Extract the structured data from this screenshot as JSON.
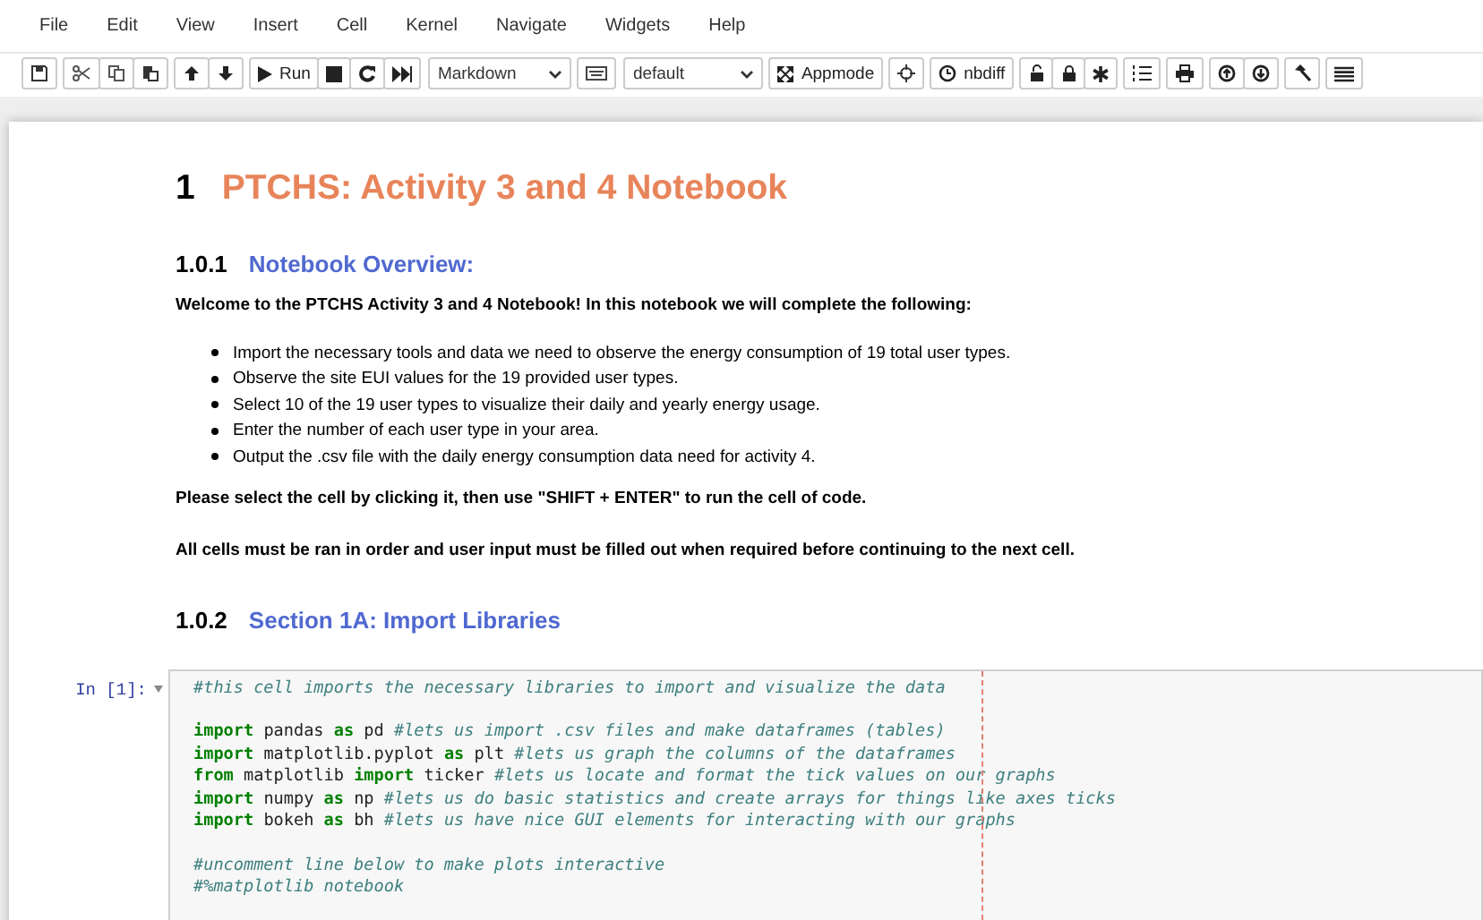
{
  "menu": [
    "File",
    "Edit",
    "View",
    "Insert",
    "Cell",
    "Kernel",
    "Navigate",
    "Widgets",
    "Help"
  ],
  "toolbar": {
    "run_label": "Run",
    "cell_type": "Markdown",
    "theme": "default",
    "appmode_label": "Appmode",
    "nbdiff_label": "nbdiff"
  },
  "heading": {
    "number": "1",
    "title": "PTCHS: Activity 3 and 4 Notebook"
  },
  "section_1": {
    "number": "1.0.1",
    "title": "Notebook Overview:"
  },
  "intro": "Welcome to the PTCHS Activity 3 and 4 Notebook! In this notebook we will complete the following:",
  "bullets": [
    "Import the necessary tools and data we need to observe the energy consumption of 19 total user types.",
    "Observe the site EUI values for the 19 provided user types.",
    "Select 10 of the 19 user types to visualize their daily and yearly energy usage.",
    "Enter the number of each user type in your area.",
    "Output the .csv file with the daily energy consumption data need for activity 4."
  ],
  "instructions": [
    "Please select the cell by clicking it, then use \"SHIFT + ENTER\" to run the cell of code.",
    "All cells must be ran in order and user input must be filled out when required before continuing to the next cell."
  ],
  "section_2": {
    "number": "1.0.2",
    "title": "Section 1A: Import Libraries"
  },
  "code_cell": {
    "prompt": "In [1]:",
    "lines": [
      {
        "blank_before": false,
        "tokens": [
          {
            "kind": "comment",
            "text": "#this cell imports the necessary libraries to import and visualize the data"
          }
        ]
      },
      {
        "blank_before": true,
        "tokens": [
          {
            "kind": "keyword",
            "text": "import"
          },
          {
            "kind": "name",
            "text": " pandas "
          },
          {
            "kind": "keyword",
            "text": "as"
          },
          {
            "kind": "name",
            "text": " pd "
          },
          {
            "kind": "comment",
            "text": "#lets us import .csv files and make dataframes (tables)"
          }
        ]
      },
      {
        "blank_before": false,
        "tokens": [
          {
            "kind": "keyword",
            "text": "import"
          },
          {
            "kind": "name",
            "text": " matplotlib.pyplot "
          },
          {
            "kind": "keyword",
            "text": "as"
          },
          {
            "kind": "name",
            "text": " plt "
          },
          {
            "kind": "comment",
            "text": "#lets us graph the columns of the dataframes"
          }
        ]
      },
      {
        "blank_before": false,
        "tokens": [
          {
            "kind": "keyword",
            "text": "from"
          },
          {
            "kind": "name",
            "text": " matplotlib "
          },
          {
            "kind": "keyword",
            "text": "import"
          },
          {
            "kind": "name",
            "text": " ticker "
          },
          {
            "kind": "comment",
            "text": "#lets us locate and format the tick values on our graphs"
          }
        ]
      },
      {
        "blank_before": false,
        "tokens": [
          {
            "kind": "keyword",
            "text": "import"
          },
          {
            "kind": "name",
            "text": " numpy "
          },
          {
            "kind": "keyword",
            "text": "as"
          },
          {
            "kind": "name",
            "text": " np "
          },
          {
            "kind": "comment",
            "text": "#lets us do basic statistics and create arrays for things like axes ticks"
          }
        ]
      },
      {
        "blank_before": false,
        "tokens": [
          {
            "kind": "keyword",
            "text": "import"
          },
          {
            "kind": "name",
            "text": " bokeh "
          },
          {
            "kind": "keyword",
            "text": "as"
          },
          {
            "kind": "name",
            "text": " bh "
          },
          {
            "kind": "comment",
            "text": "#lets us have nice GUI elements for interacting with our graphs"
          }
        ]
      },
      {
        "blank_before": true,
        "tokens": [
          {
            "kind": "comment",
            "text": "#uncomment line below to make plots interactive"
          }
        ]
      },
      {
        "blank_before": false,
        "tokens": [
          {
            "kind": "comment",
            "text": "#%matplotlib notebook"
          }
        ]
      }
    ]
  }
}
